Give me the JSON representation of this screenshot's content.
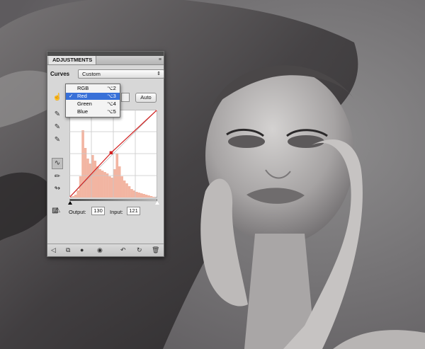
{
  "panel": {
    "tab_label": "ADJUSTMENTS",
    "menu_glyph": "≡",
    "curves_label": "Curves",
    "preset_value": "Custom",
    "auto_label": "Auto",
    "output_label": "Output:",
    "output_value": "130",
    "input_label": "Input:",
    "input_value": "121"
  },
  "channel_menu": {
    "items": [
      {
        "label": "RGB",
        "shortcut": "⌥2",
        "check": ""
      },
      {
        "label": "Red",
        "shortcut": "⌥3",
        "check": "✓"
      },
      {
        "label": "Green",
        "shortcut": "⌥4",
        "check": ""
      },
      {
        "label": "Blue",
        "shortcut": "⌥5",
        "check": ""
      }
    ],
    "selected": "Red"
  },
  "curve": {
    "points": [
      [
        0,
        0
      ],
      [
        121,
        130
      ],
      [
        255,
        255
      ]
    ],
    "curve_color": "#d32020",
    "histogram_color": "#f2b5a2"
  },
  "tool_icons": [
    "target-adjust-icon",
    "black-eyedropper-icon",
    "gray-eyedropper-icon",
    "white-eyedropper-icon",
    "curve-edit-icon",
    "pencil-draw-icon",
    "smooth-icon",
    "clipping-warning-icon"
  ],
  "bottom_icons": [
    "back-arrow-icon",
    "panel-toggle-icon",
    "layer-clip-icon",
    "eye-visibility-icon",
    "previous-state-icon",
    "reset-icon",
    "trash-icon"
  ]
}
